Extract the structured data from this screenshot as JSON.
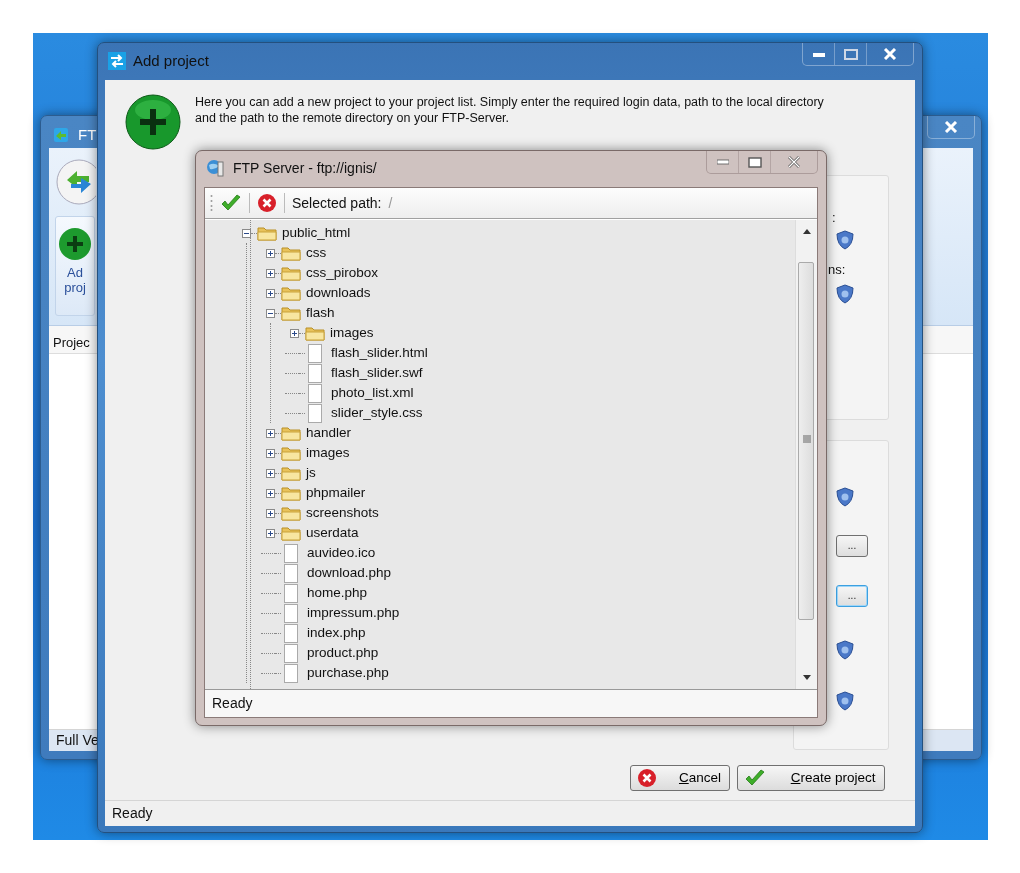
{
  "background_window": {
    "title": "FT",
    "ribbon_button_lines": [
      "Ad",
      "proj"
    ],
    "list_header": "Projec",
    "status": "Full Ve"
  },
  "add_project": {
    "title": "Add project",
    "description": "Here you can add a new project to your project list. Simply enter the required login data, path to the local directory and the path to the remote directory on your FTP-Server.",
    "field_labels": [
      ":",
      "ns:"
    ],
    "browse_buttons": [
      {
        "label": "...",
        "focused": false
      },
      {
        "label": "...",
        "focused": true
      }
    ],
    "buttons": [
      {
        "label": "Cancel",
        "kind": "cancel",
        "access_key_underlined": true
      },
      {
        "label": "Create project",
        "kind": "confirm",
        "access_key_underlined": true
      }
    ],
    "status": "Ready"
  },
  "ftp_server": {
    "title": "FTP Server - ftp://ignis/",
    "selected_path_label": "Selected path:",
    "selected_path": "/",
    "tree": [
      {
        "label": "public_html",
        "kind": "folder",
        "expanded": true,
        "children": [
          {
            "label": "css",
            "kind": "folder",
            "expanded": false
          },
          {
            "label": "css_pirobox",
            "kind": "folder",
            "expanded": false
          },
          {
            "label": "downloads",
            "kind": "folder",
            "expanded": false
          },
          {
            "label": "flash",
            "kind": "folder",
            "expanded": true,
            "children": [
              {
                "label": "images",
                "kind": "folder",
                "expanded": false
              },
              {
                "label": "flash_slider.html",
                "kind": "file"
              },
              {
                "label": "flash_slider.swf",
                "kind": "file"
              },
              {
                "label": "photo_list.xml",
                "kind": "file"
              },
              {
                "label": "slider_style.css",
                "kind": "file"
              }
            ]
          },
          {
            "label": "handler",
            "kind": "folder",
            "expanded": false
          },
          {
            "label": "images",
            "kind": "folder",
            "expanded": false
          },
          {
            "label": "js",
            "kind": "folder",
            "expanded": false
          },
          {
            "label": "phpmailer",
            "kind": "folder",
            "expanded": false
          },
          {
            "label": "screenshots",
            "kind": "folder",
            "expanded": false
          },
          {
            "label": "userdata",
            "kind": "folder",
            "expanded": false
          },
          {
            "label": "auvideo.ico",
            "kind": "file"
          },
          {
            "label": "download.php",
            "kind": "file"
          },
          {
            "label": "home.php",
            "kind": "file"
          },
          {
            "label": "impressum.php",
            "kind": "file"
          },
          {
            "label": "index.php",
            "kind": "file"
          },
          {
            "label": "product.php",
            "kind": "file"
          },
          {
            "label": "purchase.php",
            "kind": "file"
          }
        ]
      }
    ],
    "status": "Ready"
  }
}
